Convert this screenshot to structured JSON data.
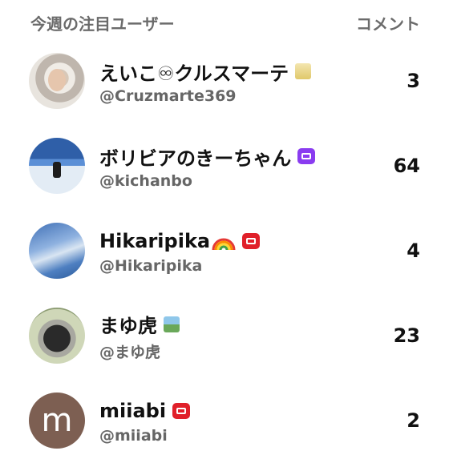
{
  "header": {
    "title": "今週の注目ユーザー",
    "column_label": "コメント"
  },
  "users": [
    {
      "name": "えいこ♾クルスマーテ",
      "handle": "@Cruzmarte369",
      "count": "3",
      "badge": "gold-image-icon"
    },
    {
      "name": "ボリビアのきーちゃん",
      "handle": "@kichanbo",
      "count": "64",
      "badge": "purple-chat-icon"
    },
    {
      "name": "Hikaripika",
      "handle": "@Hikaripika",
      "count": "4",
      "badge": "red-video-icon",
      "emoji": "rainbow-icon"
    },
    {
      "name": "まゆ虎",
      "handle": "@まゆ虎",
      "count": "23",
      "badge": "landscape-image-icon"
    },
    {
      "name": "miiabi",
      "handle": "@miiabi",
      "count": "2",
      "badge": "red-video-icon",
      "avatar_letter": "m"
    }
  ],
  "colors": {
    "purple_badge": "#8a3cf0",
    "red_badge": "#e0202a",
    "avatar_m": "#7d5f52"
  }
}
